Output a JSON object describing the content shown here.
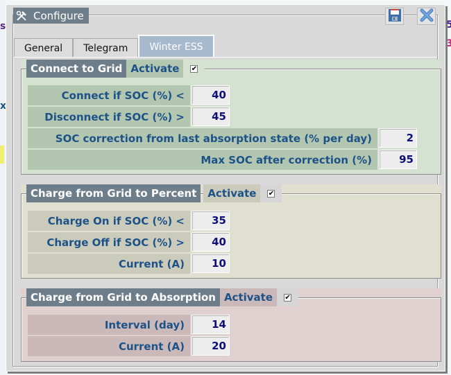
{
  "window": {
    "title": "Configure",
    "icon": "tools-icon",
    "buttons": [
      {
        "name": "save-button",
        "icon": "floppy-disk-icon"
      },
      {
        "name": "close-button",
        "icon": "close-x-icon"
      }
    ]
  },
  "tabs": [
    {
      "label": "General",
      "active": false
    },
    {
      "label": "Telegram",
      "active": false
    },
    {
      "label": "Winter ESS",
      "active": true
    }
  ],
  "sections": [
    {
      "title": "Connect to Grid",
      "activate_label": "Activate",
      "activate_checked": true,
      "color": "#d5e2d2",
      "rows": [
        {
          "label": "Connect if SOC (%) <",
          "value": "40"
        },
        {
          "label": "Disconnect if SOC (%) >",
          "value": "45"
        },
        {
          "label": "SOC correction from last absorption state (% per day)",
          "value": "2"
        },
        {
          "label": "Max SOC after correction (%)",
          "value": "95"
        }
      ]
    },
    {
      "title": "Charge from Grid to Percent",
      "activate_label": "Activate",
      "activate_checked": true,
      "color": "#e0e0d0",
      "rows": [
        {
          "label": "Charge On if SOC (%) <",
          "value": "35"
        },
        {
          "label": "Charge Off if SOC (%) >",
          "value": "40"
        },
        {
          "label": "Current (A)",
          "value": "10"
        }
      ]
    },
    {
      "title": "Charge from Grid to Absorption",
      "activate_label": "Activate",
      "activate_checked": true,
      "color": "#e0d0d0",
      "rows": [
        {
          "label": "Interval (day)",
          "value": "14"
        },
        {
          "label": "Current (A)",
          "value": "20"
        }
      ]
    }
  ],
  "check_glyph": "✔"
}
